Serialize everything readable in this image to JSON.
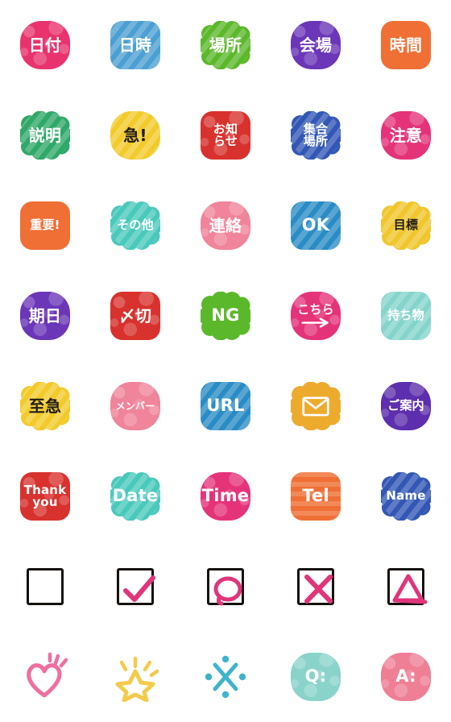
{
  "sheet": {
    "title": "Emoji Sticker Sheet",
    "columns": 5,
    "rows": 8,
    "background": "#ffffff"
  },
  "palette": {
    "pink": "#e8336e",
    "magenta": "#e5337a",
    "blue_light": "#4fa8d8",
    "blue_mid": "#2a8cc4",
    "blue_deep": "#3257b5",
    "green": "#5cb82b",
    "green_dark": "#2fa868",
    "purple": "#6b36b8",
    "purple_deep": "#5d2ead",
    "orange": "#ef6f35",
    "orange_amber": "#edab2e",
    "yellow": "#f2cb2b",
    "yellow_deep": "#f0c62c",
    "red": "#d8322e",
    "teal": "#49c9bc",
    "teal_soft": "#84d4cc",
    "teal_pale": "#8ad3cb",
    "pink_soft": "#f0849a",
    "pink_rose": "#ee7f95",
    "ink": "#15110f",
    "ink_text": "#211d14"
  },
  "stickers": [
    {
      "id": "hizuke",
      "label": "日付",
      "name": "sticker-hizuke",
      "shape": "squircle",
      "texture": "dots",
      "color": "#e8336e",
      "text_color": "#ffffff",
      "size": "jp"
    },
    {
      "id": "nichiji",
      "label": "日時",
      "name": "sticker-nichiji",
      "shape": "rounded",
      "texture": "stripes",
      "color": "#4b9fd2",
      "text_color": "#ffffff",
      "size": "jp"
    },
    {
      "id": "basho",
      "label": "場所",
      "name": "sticker-basho",
      "shape": "cloud",
      "texture": "stripes",
      "color": "#5cb82b",
      "text_color": "#ffffff",
      "size": "jp"
    },
    {
      "id": "kaijo",
      "label": "会場",
      "name": "sticker-kaijo",
      "shape": "squircle",
      "texture": "dots",
      "color": "#6b36b8",
      "text_color": "#ffffff",
      "size": "jp"
    },
    {
      "id": "jikan",
      "label": "時間",
      "name": "sticker-jikan",
      "shape": "rounded",
      "texture": "none",
      "color": "#ef6f35",
      "text_color": "#ffffff",
      "size": "jp"
    },
    {
      "id": "setsumei",
      "label": "説明",
      "name": "sticker-setsumei",
      "shape": "cloud",
      "texture": "stripes",
      "color": "#2fa868",
      "text_color": "#ffffff",
      "size": "jp"
    },
    {
      "id": "kyuu",
      "label": "急!",
      "name": "sticker-kyuu",
      "shape": "squircle",
      "texture": "stripes",
      "color": "#f2cb2b",
      "text_color": "#211d14",
      "size": "jp"
    },
    {
      "id": "oshirase",
      "label": "お知\nらせ",
      "name": "sticker-oshirase",
      "shape": "rounded",
      "texture": "dots",
      "color": "#d8322e",
      "text_color": "#ffffff",
      "size": "jp-sm"
    },
    {
      "id": "shugo-basho",
      "label": "集合\n場所",
      "name": "sticker-shugo-basho",
      "shape": "cloud",
      "texture": "stripes",
      "color": "#3257b5",
      "text_color": "#ffffff",
      "size": "jp-sm"
    },
    {
      "id": "chui",
      "label": "注意",
      "name": "sticker-chui",
      "shape": "squircle",
      "texture": "dots",
      "color": "#e5337a",
      "text_color": "#ffffff",
      "size": "jp"
    },
    {
      "id": "juyo",
      "label": "重要!",
      "name": "sticker-juyo",
      "shape": "rounded",
      "texture": "none",
      "color": "#ef6f35",
      "text_color": "#ffffff",
      "size": "jp-sm"
    },
    {
      "id": "sonota",
      "label": "その他",
      "name": "sticker-sonota",
      "shape": "cloud",
      "texture": "stripes",
      "color": "#49c9bc",
      "text_color": "#ffffff",
      "size": "jp-sm"
    },
    {
      "id": "renraku",
      "label": "連絡",
      "name": "sticker-renraku",
      "shape": "squircle",
      "texture": "dots",
      "color": "#f0849a",
      "text_color": "#ffffff",
      "size": "jp"
    },
    {
      "id": "ok",
      "label": "OK",
      "name": "sticker-ok",
      "shape": "rounded",
      "texture": "stripes",
      "color": "#2a8cc4",
      "text_color": "#ffffff",
      "size": "lat"
    },
    {
      "id": "mokuhyo",
      "label": "目標",
      "name": "sticker-mokuhyo",
      "shape": "cloud",
      "texture": "stripes",
      "color": "#f0c62c",
      "text_color": "#211d14",
      "size": "jp-sm"
    },
    {
      "id": "kijitsu",
      "label": "期日",
      "name": "sticker-kijitsu",
      "shape": "squircle",
      "texture": "dots",
      "color": "#6b36b8",
      "text_color": "#ffffff",
      "size": "jp"
    },
    {
      "id": "shimekiri",
      "label": "〆切",
      "name": "sticker-shimekiri",
      "shape": "rounded",
      "texture": "dots",
      "color": "#d8322e",
      "text_color": "#ffffff",
      "size": "jp"
    },
    {
      "id": "ng",
      "label": "NG",
      "name": "sticker-ng",
      "shape": "cloud",
      "texture": "none",
      "color": "#5cb82b",
      "text_color": "#ffffff",
      "size": "lat"
    },
    {
      "id": "kochira",
      "label": "こちら",
      "name": "sticker-kochira",
      "shape": "squircle",
      "texture": "dots",
      "color": "#e5337a",
      "text_color": "#ffffff",
      "size": "jp-sm",
      "arrow": true
    },
    {
      "id": "mochimono",
      "label": "持ち物",
      "name": "sticker-mochimono",
      "shape": "rounded",
      "texture": "stripes",
      "color": "#84d4cc",
      "text_color": "#ffffff",
      "size": "jp-sm"
    },
    {
      "id": "shikyu",
      "label": "至急",
      "name": "sticker-shikyu",
      "shape": "cloud",
      "texture": "stripes",
      "color": "#f2cb2b",
      "text_color": "#211d14",
      "size": "jp"
    },
    {
      "id": "member",
      "label": "メンバー",
      "name": "sticker-member",
      "shape": "squircle",
      "texture": "dots",
      "color": "#f0849a",
      "text_color": "#ffffff",
      "size": "jp-xs"
    },
    {
      "id": "url",
      "label": "URL",
      "name": "sticker-url",
      "shape": "rounded",
      "texture": "stripes",
      "color": "#2a8cc4",
      "text_color": "#ffffff",
      "size": "lat"
    },
    {
      "id": "mail",
      "label": "",
      "name": "sticker-mail",
      "shape": "cloud",
      "texture": "none",
      "color": "#edab2e",
      "text_color": "#ffffff",
      "size": "jp",
      "icon": "envelope-icon"
    },
    {
      "id": "goannai",
      "label": "ご案内",
      "name": "sticker-goannai",
      "shape": "squircle",
      "texture": "dots",
      "color": "#5d2ead",
      "text_color": "#ffffff",
      "size": "jp-sm"
    },
    {
      "id": "thankyou",
      "label": "Thank\nyou",
      "name": "sticker-thank-you",
      "shape": "rounded",
      "texture": "dots",
      "color": "#d8322e",
      "text_color": "#ffffff",
      "size": "lat-sm"
    },
    {
      "id": "date",
      "label": "Date",
      "name": "sticker-date",
      "shape": "cloud",
      "texture": "stripes",
      "color": "#49c9bc",
      "text_color": "#ffffff",
      "size": "lat"
    },
    {
      "id": "time",
      "label": "Time",
      "name": "sticker-time",
      "shape": "squircle",
      "texture": "dots",
      "color": "#e5337a",
      "text_color": "#ffffff",
      "size": "lat"
    },
    {
      "id": "tel",
      "label": "Tel",
      "name": "sticker-tel",
      "shape": "rounded",
      "texture": "hstripes",
      "color": "#ef6f35",
      "text_color": "#ffffff",
      "size": "lat"
    },
    {
      "id": "name",
      "label": "Name",
      "name": "sticker-name",
      "shape": "cloud",
      "texture": "stripes",
      "color": "#3257b5",
      "text_color": "#ffffff",
      "size": "lat-sm"
    },
    {
      "id": "box-empty",
      "label": "",
      "name": "checkbox-empty",
      "shape": "checkbox",
      "mark": "none"
    },
    {
      "id": "box-check",
      "label": "",
      "name": "checkbox-checked",
      "shape": "checkbox",
      "mark": "check"
    },
    {
      "id": "box-circle",
      "label": "",
      "name": "checkbox-circle",
      "shape": "checkbox",
      "mark": "circle"
    },
    {
      "id": "box-cross",
      "label": "",
      "name": "checkbox-cross",
      "shape": "checkbox",
      "mark": "cross"
    },
    {
      "id": "box-triangle",
      "label": "",
      "name": "checkbox-triangle",
      "shape": "checkbox",
      "mark": "triangle"
    },
    {
      "id": "heart",
      "label": "",
      "name": "heart-sparkle-icon",
      "shape": "symbol",
      "mark": "heart",
      "color": "#ee6fa0"
    },
    {
      "id": "star",
      "label": "",
      "name": "star-sparkle-icon",
      "shape": "symbol",
      "mark": "star",
      "color": "#f3cb4c"
    },
    {
      "id": "sparkle",
      "label": "",
      "name": "cross-sparkle-icon",
      "shape": "symbol",
      "mark": "sparkle",
      "color": "#3fb3cc"
    },
    {
      "id": "q",
      "label": "Q:",
      "name": "sticker-question",
      "shape": "squircle",
      "texture": "dots",
      "color": "#8ad3cb",
      "text_color": "#ffffff",
      "size": "lat"
    },
    {
      "id": "a",
      "label": "A:",
      "name": "sticker-answer",
      "shape": "squircle",
      "texture": "dots",
      "color": "#ee7f95",
      "text_color": "#ffffff",
      "size": "lat"
    }
  ]
}
